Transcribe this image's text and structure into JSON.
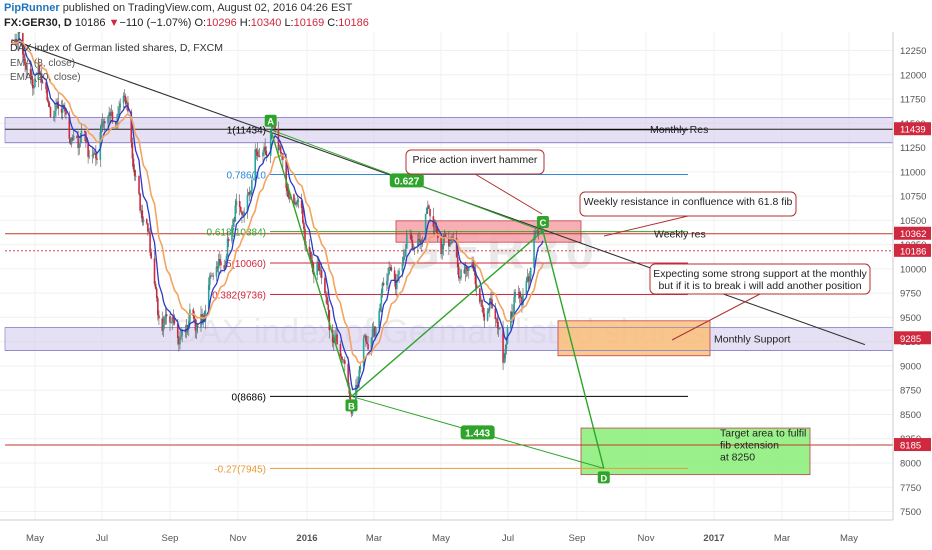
{
  "header": {
    "author": "PipRunner",
    "published": "published on TradingView.com, August 02, 2016 04:26 EST",
    "symbol": "FX:GER30, D",
    "last": "10186",
    "change_arrow": "▼",
    "change": "−110 (−1.07%)",
    "o_label": "O:",
    "o": "10296",
    "h_label": "H:",
    "h": "10340",
    "l_label": "L:",
    "l": "10169",
    "c_label": "C:",
    "c": "10186"
  },
  "legend": {
    "title": "DAX index of German listed shares, D, FXCM",
    "ma1": "EMA (8, close)",
    "ma2": "EMA (20, close)"
  },
  "watermark": {
    "symbol": "GER30",
    "name": "DAX index of German listed shares"
  },
  "colors": {
    "up": "#26a69a",
    "down": "#d0283e",
    "ema8": "#2b3ac8",
    "ema20": "#f4a460",
    "pattern": "#2ea52a",
    "zone_red": "#f7a0a8",
    "zone_orange": "#fbc07a",
    "zone_green": "#88ee77"
  },
  "chart_data": {
    "type": "candlestick",
    "title": "DAX index of German listed shares, D, FXCM",
    "ylim": [
      7300,
      12400
    ],
    "y_ticks": [
      "12250",
      "12000",
      "11750",
      "11500",
      "11250",
      "11000",
      "10750",
      "10500",
      "10250",
      "10000",
      "9750",
      "9500",
      "9250",
      "9000",
      "8750",
      "8500",
      "8250",
      "8000",
      "7750",
      "7500"
    ],
    "x_ticks": [
      "May",
      "Jul",
      "Sep",
      "Nov",
      "2016",
      "Mar",
      "May",
      "Jul",
      "Sep",
      "Nov",
      "2017",
      "Mar",
      "May"
    ],
    "price_labels": [
      {
        "value": 11439,
        "text": "11439",
        "color": "#d0283e"
      },
      {
        "value": 10362,
        "text": "10362",
        "color": "#d0283e"
      },
      {
        "value": 10186,
        "text": "10186",
        "color": "#d0283e"
      },
      {
        "value": 9285,
        "text": "9285",
        "color": "#d0283e"
      },
      {
        "value": 8185,
        "text": "8185",
        "color": "#d0283e"
      }
    ],
    "key_prices": [
      {
        "date": "2015-04-10",
        "value": 12390
      },
      {
        "date": "2015-05-15",
        "value": 11700
      },
      {
        "date": "2015-06-20",
        "value": 11200
      },
      {
        "date": "2015-07-20",
        "value": 11750
      },
      {
        "date": "2015-08-24",
        "value": 9400
      },
      {
        "date": "2015-09-24",
        "value": 9420
      },
      {
        "date": "2015-11-30",
        "value": 11434
      },
      {
        "date": "2016-01-05",
        "value": 10200
      },
      {
        "date": "2016-02-11",
        "value": 8686
      },
      {
        "date": "2016-03-15",
        "value": 9900
      },
      {
        "date": "2016-04-20",
        "value": 10480
      },
      {
        "date": "2016-05-25",
        "value": 10000
      },
      {
        "date": "2016-06-27",
        "value": 9260
      },
      {
        "date": "2016-08-02",
        "value": 10400
      }
    ],
    "fib_levels": [
      {
        "label": "1(11434)",
        "value": 11434,
        "color": "#000000"
      },
      {
        "label": "0.786(10",
        "value": 10973,
        "color": "#2a8ad6"
      },
      {
        "label": "0.618(10384)",
        "value": 10384,
        "color": "#2ea52a"
      },
      {
        "label": "5(10060)",
        "value": 10060,
        "color": "#d0283e"
      },
      {
        "label": "0.382(9736)",
        "value": 9736,
        "color": "#d0283e"
      },
      {
        "label": "0(8686)",
        "value": 8686,
        "color": "#000000"
      },
      {
        "label": "-0.27(7945)",
        "value": 7945,
        "color": "#e89a3a"
      }
    ],
    "horizontal_lines": [
      {
        "label": "Monthly Res",
        "value": 11439,
        "color": "#222222"
      },
      {
        "label": "Weekly res",
        "value": 10362,
        "color": "#c23a2a"
      },
      {
        "label": "",
        "value": 8185,
        "color": "#c23a2a"
      }
    ],
    "zones": [
      {
        "name": "monthly-res-band",
        "from": 11300,
        "to": 11560,
        "color": "#cfc6ea"
      },
      {
        "name": "monthly-support-band",
        "from": 9160,
        "to": 9395,
        "color": "#cfc6ea"
      },
      {
        "name": "weekly-resistance-box",
        "from": 10275,
        "to": 10495,
        "color": "#f7a0a8"
      },
      {
        "name": "monthly-support-box",
        "from": 9105,
        "to": 9465,
        "color": "#fbc07a"
      },
      {
        "name": "target-box",
        "from": 7880,
        "to": 8360,
        "color": "#88ee77"
      }
    ],
    "abcd_pattern": [
      {
        "label": "A",
        "date": "2015-11-30",
        "value": 11434
      },
      {
        "label": "B",
        "date": "2016-02-11",
        "value": 8686
      },
      {
        "label": "C",
        "date": "2016-08-02",
        "value": 10390
      },
      {
        "label": "D",
        "date": "2016-09-26",
        "value": 7945
      }
    ],
    "ratios": [
      {
        "label": "0.627"
      },
      {
        "label": "1.443"
      }
    ],
    "trendline": [
      {
        "date": "2015-04-10",
        "value": 12360
      },
      {
        "date": "2017-05-20",
        "value": 9220
      }
    ],
    "annotations": [
      "Monthly Res",
      "Price action invert hammer",
      "Weekly resistance in confluence with 61.8 fib",
      "Weekly res",
      "Expecting some strong support at the monthly but if it is to break i will add another position",
      "Monthly Support",
      "Target area to fulfil fib extension at 8250"
    ]
  }
}
